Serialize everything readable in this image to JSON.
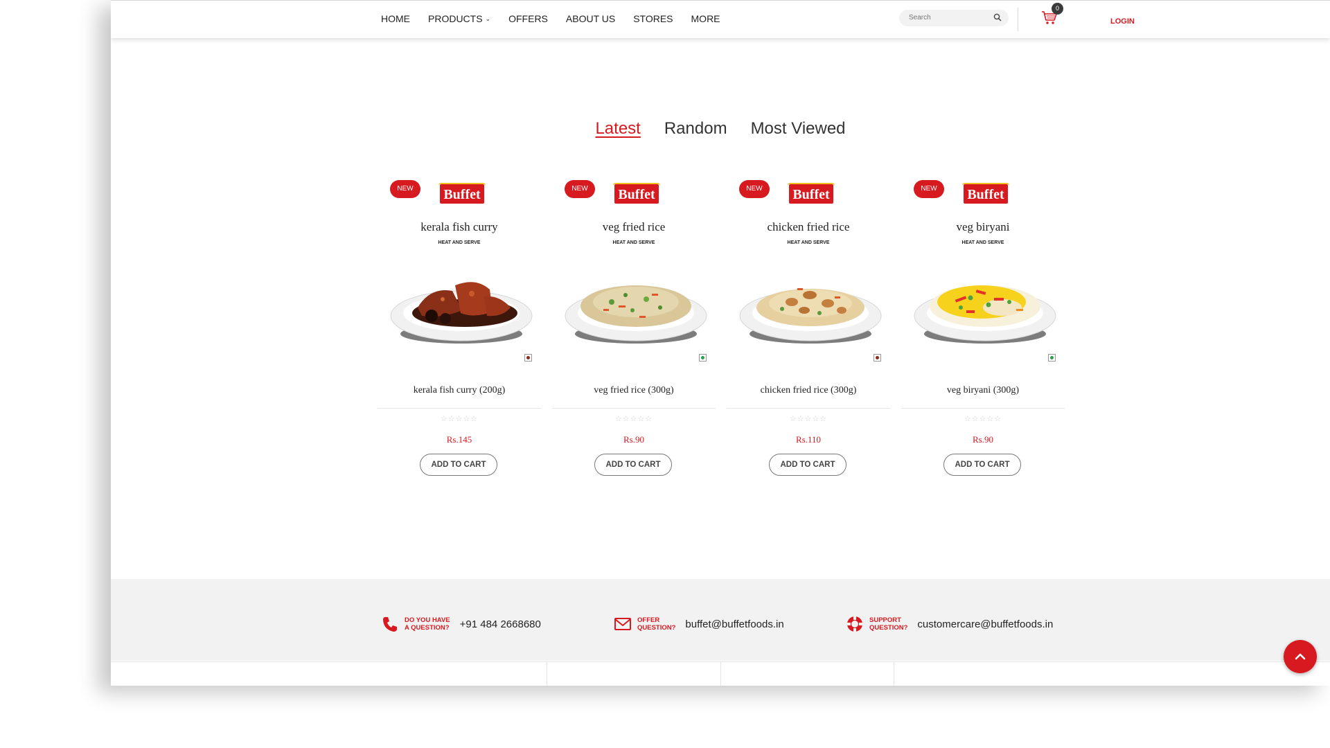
{
  "nav": {
    "items": [
      {
        "label": "HOME"
      },
      {
        "label": "PRODUCTS",
        "dropdown": true
      },
      {
        "label": "OFFERS"
      },
      {
        "label": "ABOUT US"
      },
      {
        "label": "STORES"
      },
      {
        "label": "MORE"
      }
    ],
    "search_placeholder": "Search",
    "cart_count": "0",
    "login_label": "LOGIN"
  },
  "tabs": [
    {
      "label": "Latest",
      "active": true
    },
    {
      "label": "Random",
      "active": false
    },
    {
      "label": "Most Viewed",
      "active": false
    }
  ],
  "products": [
    {
      "badge": "NEW",
      "brand": "Buffet",
      "title": "kerala fish curry",
      "subtitle": "HEAT AND SERVE",
      "name": "kerala fish curry (200g)",
      "price": "Rs.145",
      "diet": "nonveg",
      "food": "fish-curry",
      "button": "ADD TO CART",
      "rating": "☆☆☆☆☆"
    },
    {
      "badge": "NEW",
      "brand": "Buffet",
      "title": "veg fried rice",
      "subtitle": "HEAT AND SERVE",
      "name": "veg fried rice (300g)",
      "price": "Rs.90",
      "diet": "veg",
      "food": "fried-rice",
      "button": "ADD TO CART",
      "rating": "☆☆☆☆☆"
    },
    {
      "badge": "NEW",
      "brand": "Buffet",
      "title": "chicken fried rice",
      "subtitle": "HEAT AND SERVE",
      "name": "chicken fried rice (300g)",
      "price": "Rs.110",
      "diet": "nonveg",
      "food": "chicken-rice",
      "button": "ADD TO CART",
      "rating": "☆☆☆☆☆"
    },
    {
      "badge": "NEW",
      "brand": "Buffet",
      "title": "veg biryani",
      "subtitle": "HEAT AND SERVE",
      "name": "veg biryani (300g)",
      "price": "Rs.90",
      "diet": "veg",
      "food": "biryani",
      "button": "ADD TO CART",
      "rating": "☆☆☆☆☆"
    }
  ],
  "footer": {
    "contacts": [
      {
        "label_line1": "DO YOU HAVE",
        "label_line2": "A QUESTION?",
        "value": "+91 484 2668680",
        "icon": "phone-icon"
      },
      {
        "label_line1": "OFFER",
        "label_line2": "QUESTION?",
        "value": "buffet@buffetfoods.in",
        "icon": "envelope-icon"
      },
      {
        "label_line1": "SUPPORT",
        "label_line2": "QUESTION?",
        "value": "customercare@buffetfoods.in",
        "icon": "lifebuoy-icon"
      }
    ]
  },
  "colors": {
    "accent": "#d71920",
    "veg": "#2e9e4f",
    "nonveg": "#8b2a1a",
    "footer_bg": "#f2f2f2"
  }
}
